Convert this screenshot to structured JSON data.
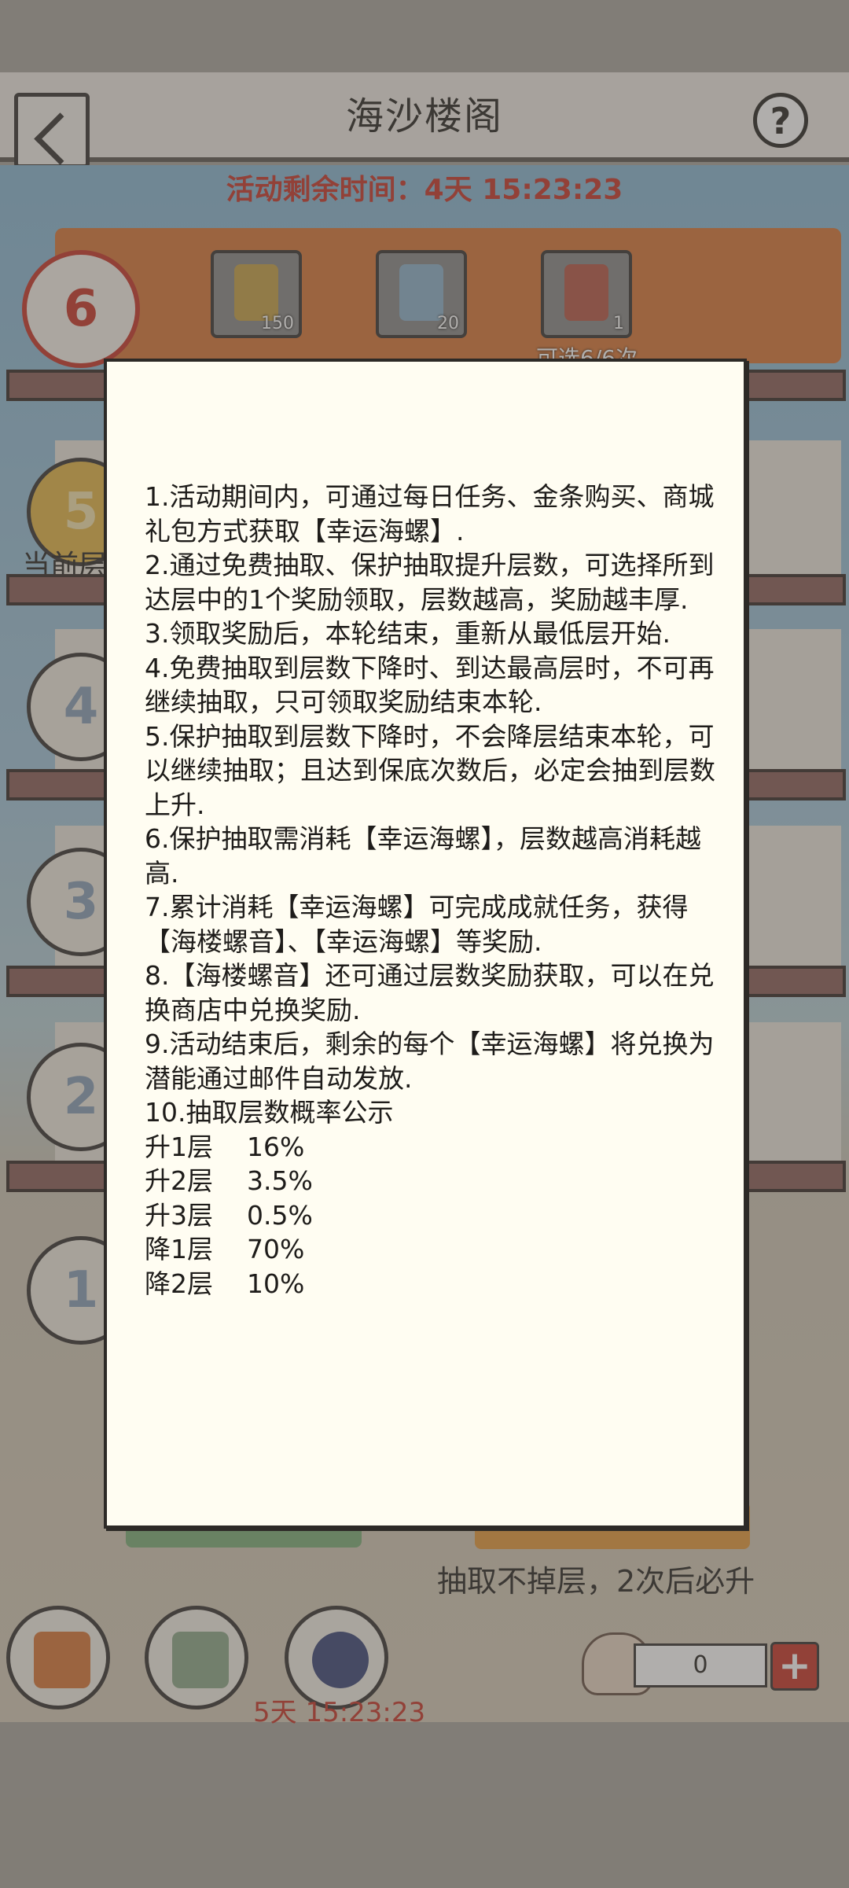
{
  "header": {
    "title": "海沙楼阁",
    "help": "?"
  },
  "event_timer": "活动剩余时间：4天 15:23:23",
  "reward_items": [
    {
      "icon": "gold-plaque-icon",
      "count": "150"
    },
    {
      "icon": "blue-talisman-icon",
      "count": "20"
    },
    {
      "icon": "gift-pile-icon",
      "count": "1"
    }
  ],
  "optional_text": "可选6/6次",
  "floors": {
    "current_top": "6",
    "labels": [
      "5",
      "4",
      "3",
      "2",
      "1"
    ],
    "current_label": "当前层"
  },
  "bottom": {
    "guarantee_text": "抽取不掉层，2次后必升",
    "timer": "5天 15:23:23",
    "counter_value": "0",
    "plus": "+"
  },
  "dialog": {
    "rules": [
      "1.活动期间内，可通过每日任务、金条购买、商城礼包方式获取【幸运海螺】.",
      "2.通过免费抽取、保护抽取提升层数，可选择所到达层中的1个奖励领取，层数越高，奖励越丰厚.",
      "3.领取奖励后，本轮结束，重新从最低层开始.",
      "4.免费抽取到层数下降时、到达最高层时，不可再继续抽取，只可领取奖励结束本轮.",
      "5.保护抽取到层数下降时，不会降层结束本轮，可以继续抽取；且达到保底次数后，必定会抽到层数上升.",
      "6.保护抽取需消耗【幸运海螺】，层数越高消耗越高.",
      "7.累计消耗【幸运海螺】可完成成就任务，获得【海楼螺音】、【幸运海螺】等奖励.",
      "8.【海楼螺音】还可通过层数奖励获取，可以在兑换商店中兑换奖励.",
      "9.活动结束后，剩余的每个【幸运海螺】将兑换为潜能通过邮件自动发放.",
      "10.抽取层数概率公示"
    ],
    "probabilities": [
      {
        "label": "升1层",
        "value": "16%"
      },
      {
        "label": "升2层",
        "value": "3.5%"
      },
      {
        "label": "升3层",
        "value": "0.5%"
      },
      {
        "label": "降1层",
        "value": "70%"
      },
      {
        "label": "降2层",
        "value": "10%"
      }
    ]
  },
  "colors": {
    "accent_red": "#c83a2c",
    "orange": "#d9793b",
    "dialog_bg": "#fffdf2"
  }
}
